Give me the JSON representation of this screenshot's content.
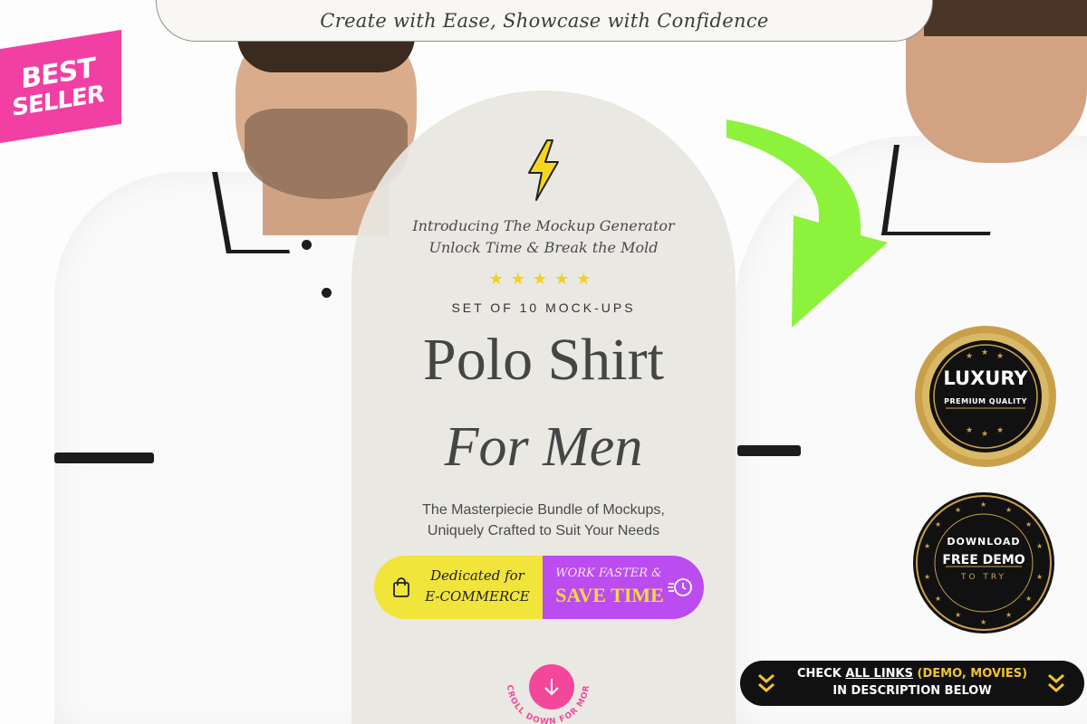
{
  "tagline": "Create with Ease, Showcase with Confidence",
  "badge": {
    "line1": "BEST",
    "line2": "SELLER",
    "color": "#f23fa4"
  },
  "panel": {
    "intro_line1": "Introducing The Mockup Generator",
    "intro_line2": "Unlock Time & Break the Mold",
    "stars": "★★★★★",
    "set_label": "SET OF 10 MOCK-UPS",
    "title_line1": "Polo Shirt",
    "title_line2": "For Men",
    "desc_line1": "The Masterpiecie Bundle of Mockups,",
    "desc_line2": "Uniquely Crafted to Suit Your Needs"
  },
  "pill": {
    "left_line1": "Dedicated for",
    "left_line2": "E-COMMERCE",
    "right_line1": "WORK FASTER &",
    "right_line2": "SAVE TIME",
    "left_color": "#f1e43a",
    "right_color": "#bb4cf0"
  },
  "scroll": {
    "label": "SCROLL DOWN FOR MORE"
  },
  "seal_luxury": {
    "title": "LUXURY",
    "subtitle": "PREMIUM QUALITY"
  },
  "seal_demo": {
    "line1": "DOWNLOAD",
    "line2": "FREE DEMO",
    "line3": "TO TRY"
  },
  "links_bar": {
    "check": "CHECK",
    "all_links": "ALL LINKS",
    "paren": "(DEMO, MOVIES)",
    "line2": "IN DESCRIPTION BELOW"
  },
  "icons": [
    "lightning-icon",
    "shopping-bag-icon",
    "clock-icon",
    "arrow-down-icon",
    "chevron-down-icon"
  ],
  "accent_colors": {
    "green_arrow": "#8df23c",
    "gold": "#c9a04a"
  }
}
